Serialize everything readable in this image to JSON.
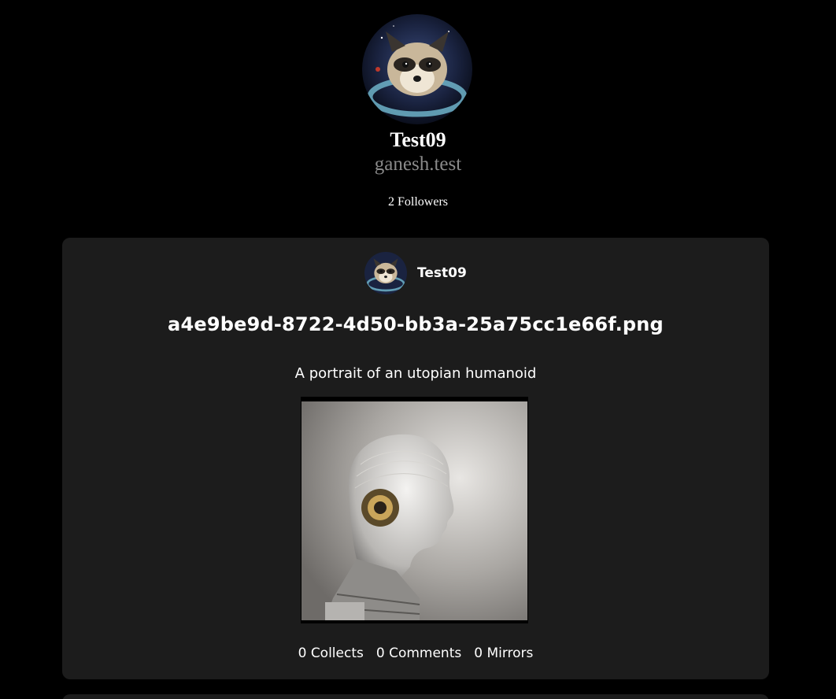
{
  "profile": {
    "name": "Test09",
    "handle": "ganesh.test",
    "followers": "2 Followers",
    "avatar_icon": "raccoon-astronaut-avatar"
  },
  "post": {
    "author_name": "Test09",
    "title": "a4e9be9d-8722-4d50-bb3a-25a75cc1e66f.png",
    "description": "A portrait of an utopian humanoid",
    "image_icon": "humanoid-portrait-image",
    "stats": {
      "collects": "0 Collects",
      "comments": "0 Comments",
      "mirrors": "0 Mirrors"
    }
  },
  "colors": {
    "background": "#000000",
    "card": "#1c1c1c",
    "handle_text": "#8a8a8a",
    "text": "#ffffff"
  }
}
